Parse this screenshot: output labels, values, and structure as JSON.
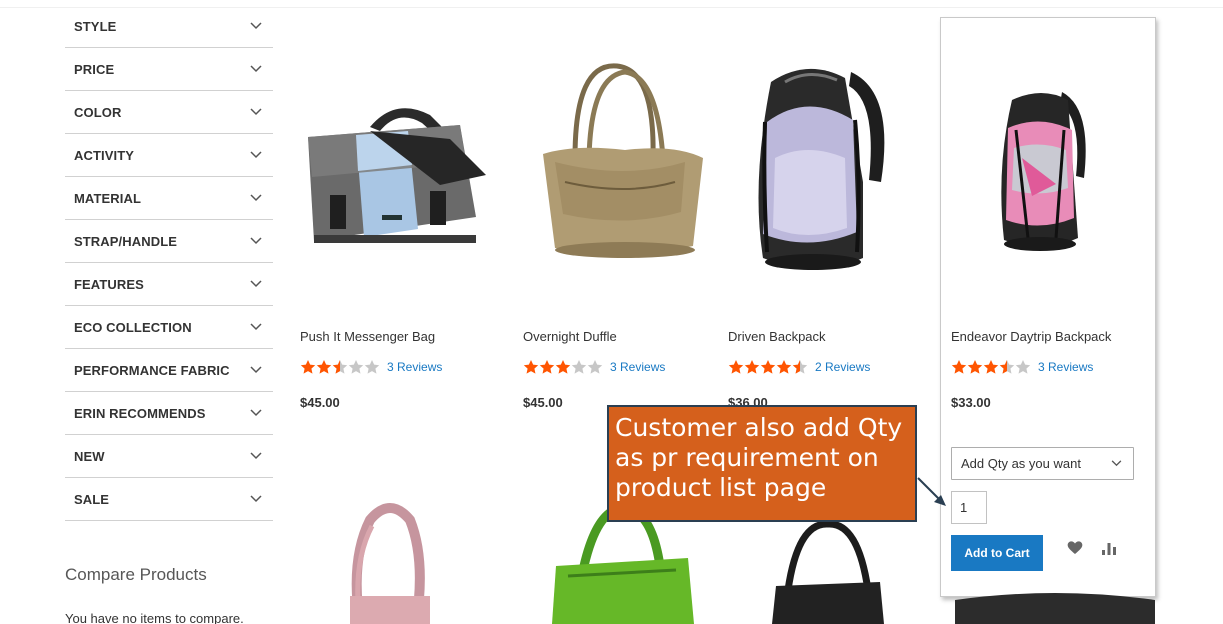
{
  "filters": [
    {
      "label": "STYLE"
    },
    {
      "label": "PRICE"
    },
    {
      "label": "COLOR"
    },
    {
      "label": "ACTIVITY"
    },
    {
      "label": "MATERIAL"
    },
    {
      "label": "STRAP/HANDLE"
    },
    {
      "label": "FEATURES"
    },
    {
      "label": "ECO COLLECTION"
    },
    {
      "label": "PERFORMANCE FABRIC"
    },
    {
      "label": "ERIN RECOMMENDS"
    },
    {
      "label": "NEW"
    },
    {
      "label": "SALE"
    }
  ],
  "compare": {
    "title": "Compare Products",
    "empty_text": "You have no items to compare."
  },
  "products": [
    {
      "name": "Push It Messenger Bag",
      "rating": 2.5,
      "reviews": "3 Reviews",
      "price": "$45.00"
    },
    {
      "name": "Overnight Duffle",
      "rating": 3,
      "reviews": "3 Reviews",
      "price": "$45.00"
    },
    {
      "name": "Driven Backpack",
      "rating": 4.5,
      "reviews": "2 Reviews",
      "price": "$36.00"
    },
    {
      "name": "Endeavor Daytrip Backpack",
      "rating": 3.5,
      "reviews": "3 Reviews",
      "price": "$33.00"
    }
  ],
  "hover_product": {
    "qty_select": "Add Qty as you want",
    "qty_value": "1",
    "add_to_cart": "Add to Cart",
    "wishlist_icon": "heart-icon",
    "compare_icon": "bar-chart-icon"
  },
  "callout": {
    "line1": "Customer also add Qty",
    "line2": "as pr requirement on",
    "line3": "product list page"
  },
  "colors": {
    "accent": "#1979c3",
    "star": "#ff5501",
    "callout": "#d5601c"
  }
}
